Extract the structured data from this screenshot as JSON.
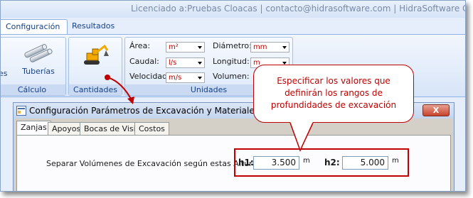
{
  "window": {
    "title": "Licenciado a:Pruebas Cloacas | contacto@hidrasoftware.com | HidraSoftware    C:\\aaaa\\Cl"
  },
  "tabs": [
    {
      "label": "Configuración",
      "active": true
    },
    {
      "label": "Resultados",
      "active": false
    }
  ],
  "ribbon": {
    "groups": {
      "calculo": {
        "label": "Cálculo",
        "items": [
          "es",
          "Tuberías"
        ]
      },
      "cantidades": {
        "label": "Cantidades"
      },
      "unidades": {
        "label": "Unidades",
        "fields": [
          {
            "label": "Área:",
            "value": "m²"
          },
          {
            "label": "Caudal:",
            "value": "l/s"
          },
          {
            "label": "Velocidad:",
            "value": "m/s"
          },
          {
            "label": "Diámetro:",
            "value": "mm"
          },
          {
            "label": "Longitud:",
            "value": "m"
          },
          {
            "label": "Volumen:",
            "value": ""
          }
        ]
      }
    }
  },
  "callout": {
    "text_lines": [
      "Especificar los valores que",
      "definirán los rangos de",
      "profundidades de excavación"
    ]
  },
  "dialog": {
    "title": "Configuración Parámetros de Excavación y Materiales",
    "close_label": "X",
    "tabs": [
      "Zanjas",
      "Apoyos",
      "Bocas de Visita",
      "Costos"
    ],
    "separator_label": "Separar Volúmenes de Excavación según estas Alturas:",
    "h1": {
      "label": "h1:",
      "value": "3.500",
      "unit": "m"
    },
    "h2": {
      "label": "h2:",
      "value": "5.000",
      "unit": "m"
    }
  },
  "colors": {
    "accent": "#c00000",
    "ribbon_text": "#15428b"
  }
}
